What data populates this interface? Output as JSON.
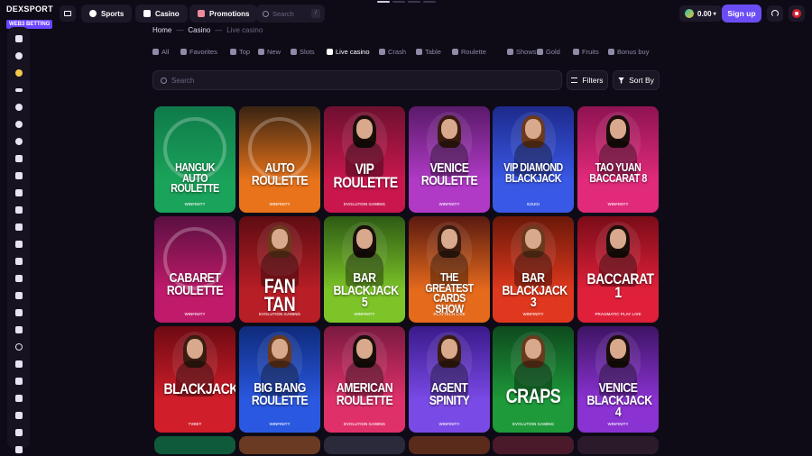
{
  "logo": {
    "brand": "DEXSPORT",
    "tag": "WEB3 BETTING"
  },
  "top_nav": [
    {
      "label": "Sports",
      "icon": "ball-icon"
    },
    {
      "label": "Casino",
      "icon": "dice-icon"
    },
    {
      "label": "Promotions",
      "icon": "gift-icon"
    }
  ],
  "top_search": {
    "placeholder": "Search",
    "shortcut": "/"
  },
  "balance": {
    "amount": "0.00"
  },
  "signup_label": "Sign up",
  "breadcrumb": {
    "home": "Home",
    "casino": "Casino",
    "current": "Live casino",
    "sep": "—"
  },
  "categories": [
    {
      "label": "All",
      "icon": "grid-icon",
      "active": false
    },
    {
      "label": "Favorites",
      "icon": "heart-icon",
      "active": false
    },
    {
      "label": "Top",
      "icon": "chart-icon",
      "active": false
    },
    {
      "label": "New",
      "icon": "sparkle-icon",
      "active": false
    },
    {
      "label": "Slots",
      "icon": "slot-icon",
      "active": false
    },
    {
      "label": "Live casino",
      "icon": "live-icon",
      "active": true
    },
    {
      "label": "Crash",
      "icon": "rocket-icon",
      "active": false
    },
    {
      "label": "Table",
      "icon": "table-icon",
      "active": false
    },
    {
      "label": "Roulette",
      "icon": "roulette-icon",
      "active": false
    },
    {
      "label": "Shows",
      "icon": "show-icon",
      "active": false
    },
    {
      "label": "Gold",
      "icon": "gold-icon",
      "active": false
    },
    {
      "label": "Fruits",
      "icon": "fruit-icon",
      "active": false
    },
    {
      "label": "Bonus buy",
      "icon": "bonus-icon",
      "active": false
    }
  ],
  "search": {
    "placeholder": "Search"
  },
  "filters_label": "Filters",
  "sort_label": "Sort By",
  "games": [
    {
      "name": "Hanguk Auto Roulette",
      "provider": "Winfinity",
      "bg": "#0f7a4a",
      "bg2": "#1aa35a",
      "kind": "wheel"
    },
    {
      "name": "Auto Roulette",
      "provider": "Winfinity",
      "bg": "#3a2412",
      "bg2": "#e8731a",
      "kind": "wheel"
    },
    {
      "name": "VIP Roulette",
      "provider": "Evolution Gaming",
      "bg": "#6e1030",
      "bg2": "#c9174d",
      "kind": "dealer"
    },
    {
      "name": "Venice Roulette",
      "provider": "Winfinity",
      "bg": "#5a1a6a",
      "bg2": "#b03ac6",
      "kind": "dealer"
    },
    {
      "name": "VIP Diamond Blackjack",
      "provider": "Ezugi",
      "bg": "#1d2a8c",
      "bg2": "#3a58e6",
      "kind": "dealer"
    },
    {
      "name": "Tao Yuan Baccarat 8",
      "provider": "Winfinity",
      "bg": "#8e1352",
      "bg2": "#e12a7a",
      "kind": "dealer"
    },
    {
      "name": "Cabaret Roulette",
      "provider": "Winfinity",
      "bg": "#5a1042",
      "bg2": "#c01a6a",
      "kind": "wheel"
    },
    {
      "name": "Fan Tan",
      "provider": "Evolution Gaming",
      "bg": "#5e0c12",
      "bg2": "#b81e26",
      "kind": "dealer"
    },
    {
      "name": "Bar Blackjack 5",
      "provider": "Winfinity",
      "bg": "#2e5a14",
      "bg2": "#7cc428",
      "kind": "dealer"
    },
    {
      "name": "The Greatest Cards Show",
      "provider": "Playtech Live",
      "bg": "#5a1a10",
      "bg2": "#e66a1c",
      "kind": "dealer"
    },
    {
      "name": "Bar Blackjack 3",
      "provider": "Winfinity",
      "bg": "#6a1808",
      "bg2": "#e0381e",
      "kind": "dealer"
    },
    {
      "name": "Baccarat 1",
      "provider": "Pragmatic Play Live",
      "bg": "#7a0c18",
      "bg2": "#e0203a",
      "kind": "dealer"
    },
    {
      "name": "Blackjack",
      "provider": "TVBet",
      "bg": "#6e0a12",
      "bg2": "#d01e2a",
      "kind": "dealer"
    },
    {
      "name": "Big Bang Roulette",
      "provider": "Winfinity",
      "bg": "#0e2a7a",
      "bg2": "#2a58e0",
      "kind": "dealer"
    },
    {
      "name": "American Roulette",
      "provider": "Evolution Gaming",
      "bg": "#7a1a40",
      "bg2": "#e0306a",
      "kind": "dealer"
    },
    {
      "name": "Agent Spinity",
      "provider": "Winfinity",
      "bg": "#3a1a8a",
      "bg2": "#7a4ae6",
      "kind": "dealer"
    },
    {
      "name": "Craps",
      "provider": "Evolution Gaming",
      "bg": "#0e4a1e",
      "bg2": "#1e9a3a",
      "kind": "dealer"
    },
    {
      "name": "Venice Blackjack 4",
      "provider": "Winfinity",
      "bg": "#3e1464",
      "bg2": "#8a32d2",
      "kind": "dealer"
    }
  ],
  "partial_cards": [
    {
      "bg": "#0f5a3a"
    },
    {
      "bg": "#6a3a22"
    },
    {
      "bg": "#2a2a3a"
    },
    {
      "bg": "#5a2a1a"
    },
    {
      "bg": "#4a1a2a"
    },
    {
      "bg": "#2a1a2a"
    }
  ]
}
